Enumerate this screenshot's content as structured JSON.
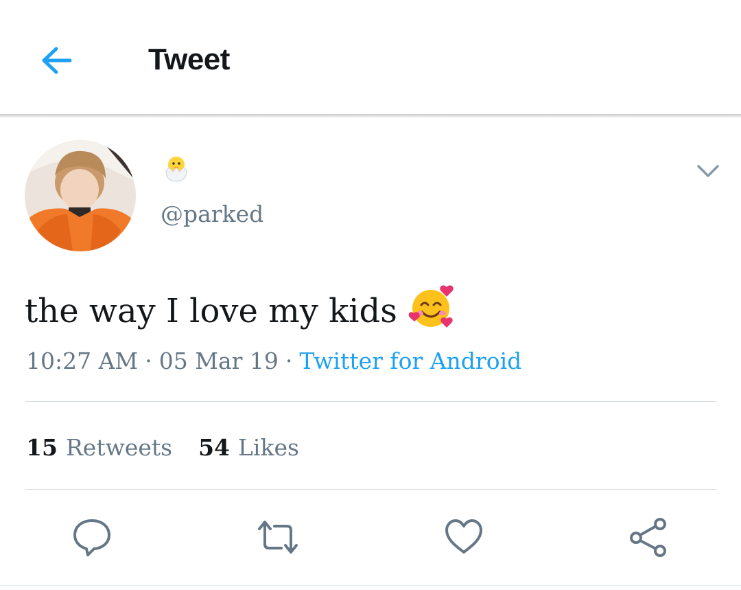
{
  "header": {
    "title": "Tweet",
    "back_icon": "arrow-left-icon",
    "accent": "#1da1f2"
  },
  "author": {
    "display_name_icon": "hatching-chick-emoji",
    "handle": "@parked",
    "avatar_icon": "profile-avatar-photo"
  },
  "tweet": {
    "text": "the way I love my kids",
    "emoji": "smiling-face-with-hearts-emoji",
    "time": "10:27 AM",
    "separator": "·",
    "date": "05 Mar 19",
    "source": "Twitter for Android"
  },
  "stats": {
    "retweets_count": "15",
    "retweets_label": "Retweets",
    "likes_count": "54",
    "likes_label": "Likes"
  },
  "actions": [
    "reply-icon",
    "retweet-icon",
    "like-icon",
    "share-icon"
  ],
  "colors": {
    "text": "#14171a",
    "secondary": "#657786",
    "link": "#1da1f2",
    "icon": "#657786"
  }
}
